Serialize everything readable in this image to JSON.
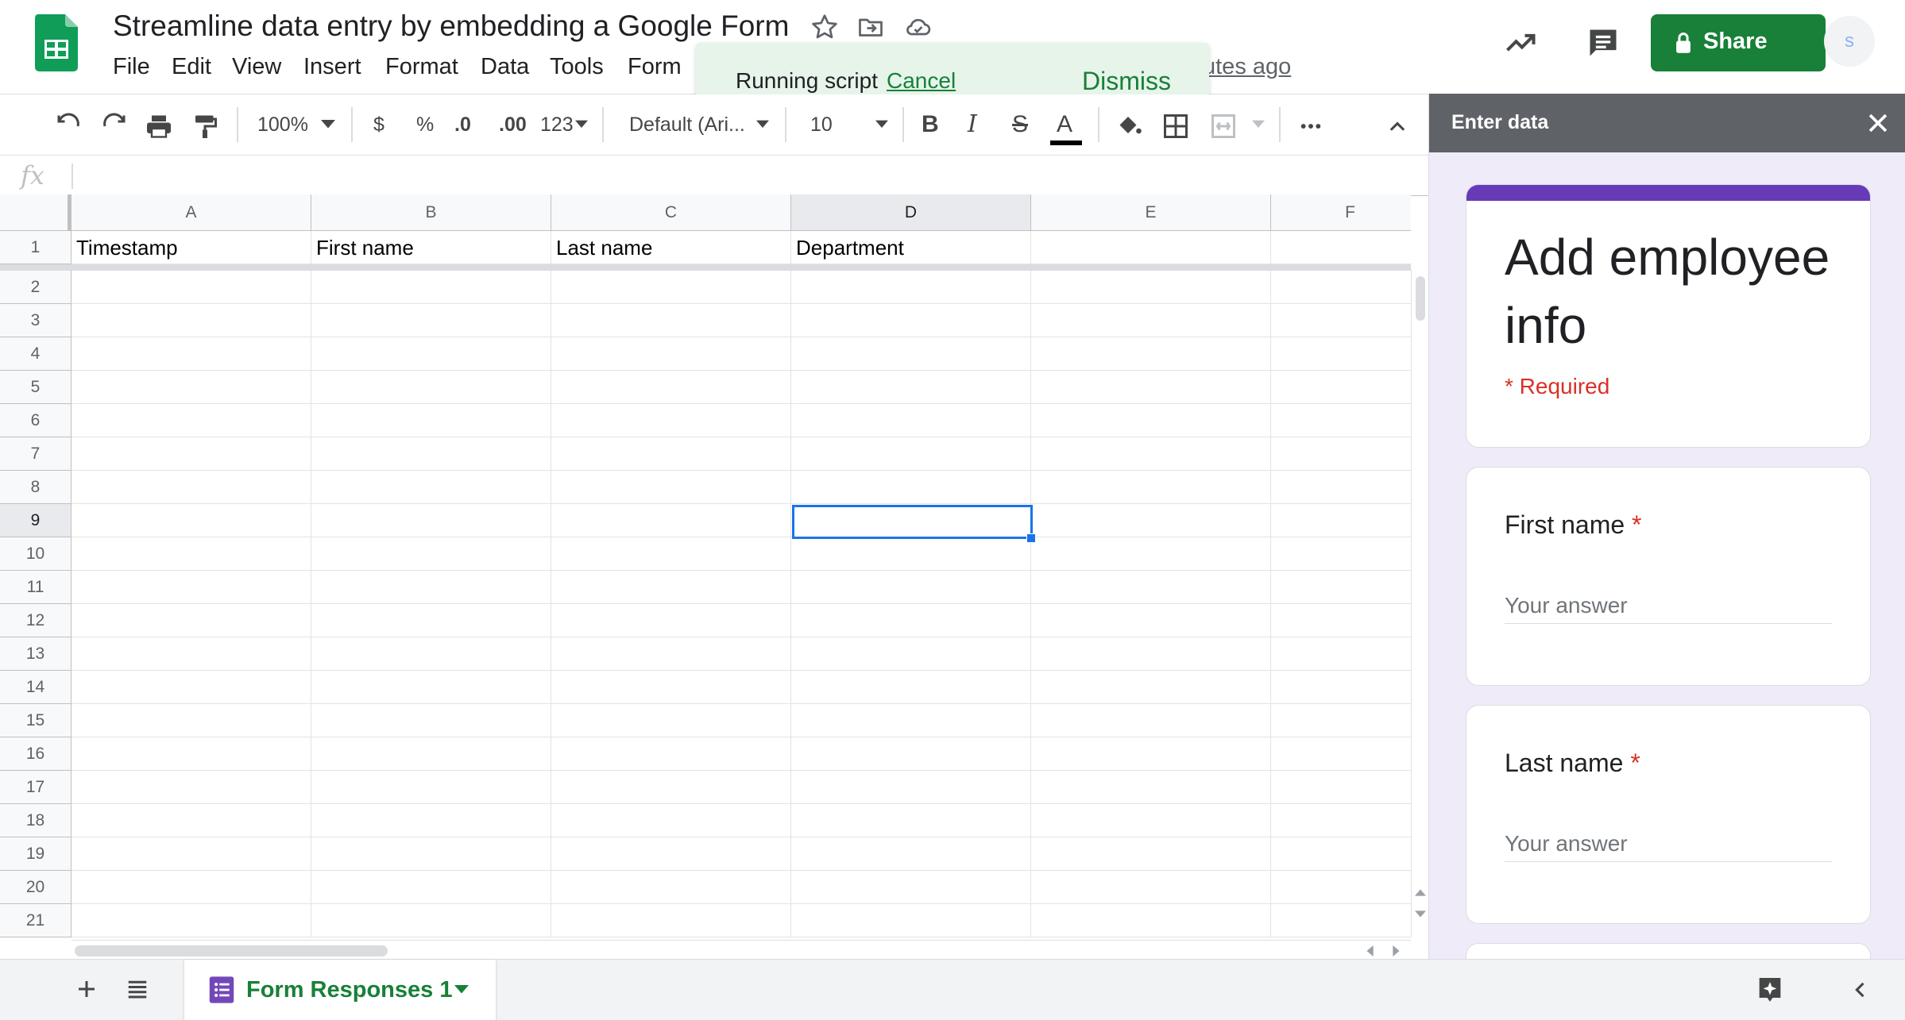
{
  "header": {
    "title": "Streamline data entry by embedding a Google Form",
    "menu": [
      "File",
      "Edit",
      "View",
      "Insert",
      "Format",
      "Data",
      "Tools",
      "Form"
    ],
    "last_edit": "utes ago",
    "share_label": "Share",
    "avatar_initial": "s",
    "icons": [
      "sheets-logo",
      "star-icon",
      "move-folder-icon",
      "cloud-status-icon",
      "trending-icon",
      "comment-icon",
      "lock-icon"
    ]
  },
  "toast": {
    "message": "Running script",
    "cancel_label": "Cancel",
    "dismiss_label": "Dismiss"
  },
  "toolbar": {
    "zoom": "100%",
    "currency": "$",
    "percent": "%",
    "decrease_decimal": ".0",
    "increase_decimal": ".00",
    "more_formats": "123",
    "font": "Default (Ari...",
    "font_size": "10",
    "bold": "B",
    "italic": "I",
    "strike": "S",
    "text_color": "A"
  },
  "formula_bar": {
    "fx": "fx",
    "value": ""
  },
  "grid": {
    "columns": [
      "A",
      "B",
      "C",
      "D",
      "E",
      "F"
    ],
    "selected_column": "D",
    "rows": [
      "1",
      "2",
      "3",
      "4",
      "5",
      "6",
      "7",
      "8",
      "9",
      "10",
      "11",
      "12",
      "13",
      "14",
      "15",
      "16",
      "17",
      "18",
      "19",
      "20",
      "21"
    ],
    "selected_row": "9",
    "headers": [
      "Timestamp",
      "First name",
      "Last name",
      "Department"
    ],
    "selected_cell": "D9"
  },
  "sheets": {
    "active_tab": "Form Responses 1"
  },
  "side_panel": {
    "title": "Enter data",
    "form_title": "Add employee info",
    "required_note": "* Required",
    "questions": [
      {
        "label": "First name",
        "required_mark": "*",
        "placeholder": "Your answer"
      },
      {
        "label": "Last name",
        "required_mark": "*",
        "placeholder": "Your answer"
      }
    ]
  },
  "colors": {
    "accent_green": "#188038",
    "form_purple": "#673ab7",
    "selection_blue": "#1a73e8",
    "required_red": "#d93025"
  }
}
